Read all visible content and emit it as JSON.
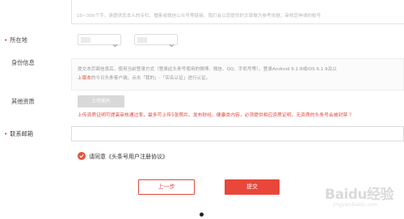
{
  "bio": {
    "hint": "10~300个字，请提供您本人的专栏、播客或微信公众号等链接，我们会以您提供的文章做为参考依据，审核您申请的帐号"
  },
  "location": {
    "required_mark": "•",
    "label": "所在地"
  },
  "identity": {
    "label": "身份信息",
    "line1": "提交本页面信息后，使用当前登录方式（登录此头条号使用的微博、微信、QQ、手机号等），登录Android 6.1.8或iOS 6.1.9及以",
    "line2_red": "上版本",
    "line2_rest": "的今日头条客户端，点击「我的」-「实名认证」进行认证。"
  },
  "other": {
    "label": "其他资质",
    "upload_label": "上传图片",
    "warning": "上传资质证明可提高审核通过率，最多可上传5张照片。发布财经、健康类内容，必须提供相应资质证明，无资质的头条号会被封禁 ？"
  },
  "email": {
    "required_mark": "•",
    "label": "联系邮箱"
  },
  "agreement": {
    "text": "请同意《头条号用户注册协议》"
  },
  "buttons": {
    "prev": "上一步",
    "submit": "提交"
  },
  "watermark": {
    "logo": "Baidu经验",
    "sub": "jingyan.baidu.com"
  },
  "colors": {
    "accent": "#e8473a",
    "warning": "#e04a3c"
  }
}
